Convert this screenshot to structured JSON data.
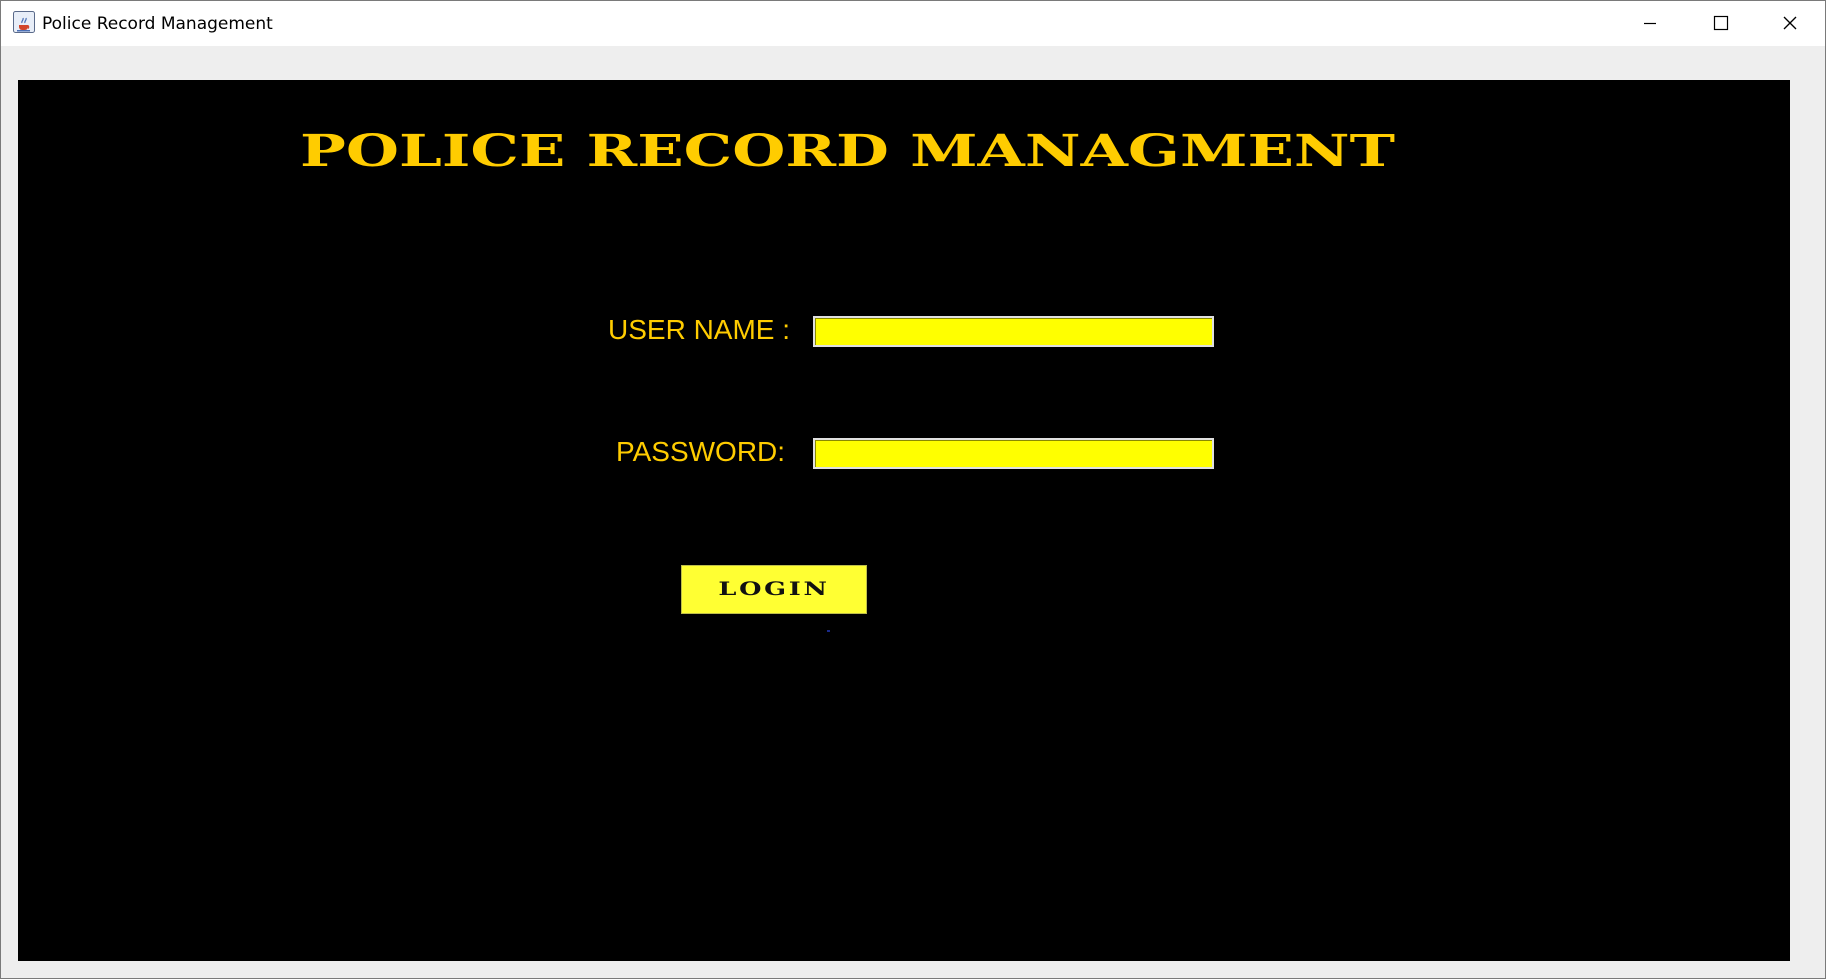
{
  "window": {
    "title": "Police Record Management",
    "icon": "java-cup-icon",
    "controls": [
      "minimize-icon",
      "maximize-icon",
      "close-icon"
    ]
  },
  "main": {
    "heading": "POLICE RECORD MANAGMENT",
    "heading_color": "#ffcc00",
    "background_color": "#000000",
    "username_label": "USER NAME :",
    "username_value": "",
    "password_label": "PASSWORD:",
    "password_value": "",
    "field_color": "#ffff00",
    "login_label": "LOGIN"
  }
}
